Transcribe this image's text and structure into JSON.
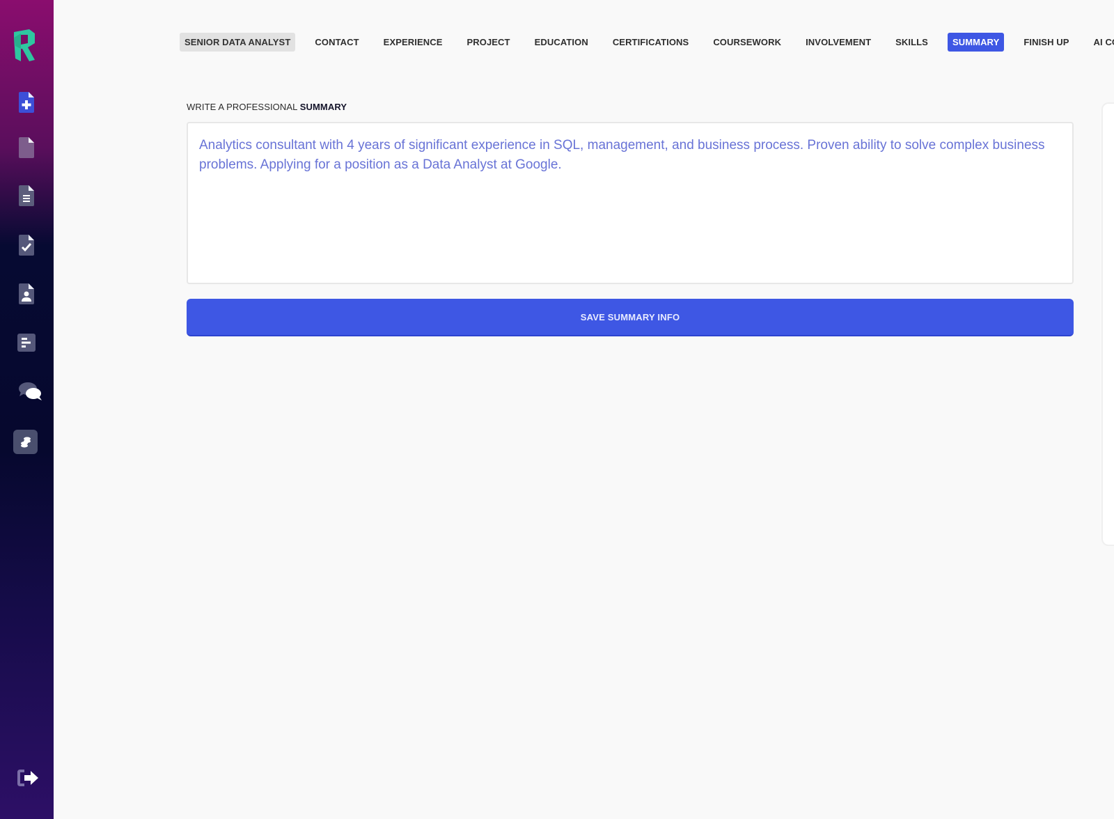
{
  "app": {
    "brand_letter": "R",
    "brand_color": "#2ec7a0",
    "accent_color": "#3e57e4"
  },
  "sidebar": {
    "items": [
      {
        "name": "new-resume",
        "icon": "file-plus-icon"
      },
      {
        "name": "resumes",
        "icon": "file-icon"
      },
      {
        "name": "documents",
        "icon": "file-lines-icon"
      },
      {
        "name": "resume-check",
        "icon": "file-check-icon"
      },
      {
        "name": "contacts",
        "icon": "file-user-icon"
      },
      {
        "name": "reports",
        "icon": "bars-icon"
      },
      {
        "name": "messages",
        "icon": "comments-icon"
      },
      {
        "name": "credits",
        "icon": "coins-icon"
      }
    ],
    "logout_icon": "sign-out-icon"
  },
  "nav": {
    "tabs": [
      {
        "label": "SENIOR DATA ANALYST",
        "state": "document"
      },
      {
        "label": "CONTACT",
        "state": "normal"
      },
      {
        "label": "EXPERIENCE",
        "state": "normal"
      },
      {
        "label": "PROJECT",
        "state": "normal"
      },
      {
        "label": "EDUCATION",
        "state": "normal"
      },
      {
        "label": "CERTIFICATIONS",
        "state": "normal"
      },
      {
        "label": "COURSEWORK",
        "state": "normal"
      },
      {
        "label": "INVOLVEMENT",
        "state": "normal"
      },
      {
        "label": "SKILLS",
        "state": "normal"
      },
      {
        "label": "SUMMARY",
        "state": "active"
      },
      {
        "label": "FINISH UP",
        "state": "normal"
      },
      {
        "label": "AI COVER LETTER",
        "state": "normal"
      }
    ]
  },
  "summary": {
    "label_prefix": "WRITE A PROFESSIONAL ",
    "label_bold": "SUMMARY",
    "text": "Analytics consultant with 4 years of significant experience in SQL, management, and business process. Proven ability to solve complex business problems. Applying for a position as a Data Analyst at Google.",
    "save_label": "SAVE SUMMARY INFO"
  }
}
